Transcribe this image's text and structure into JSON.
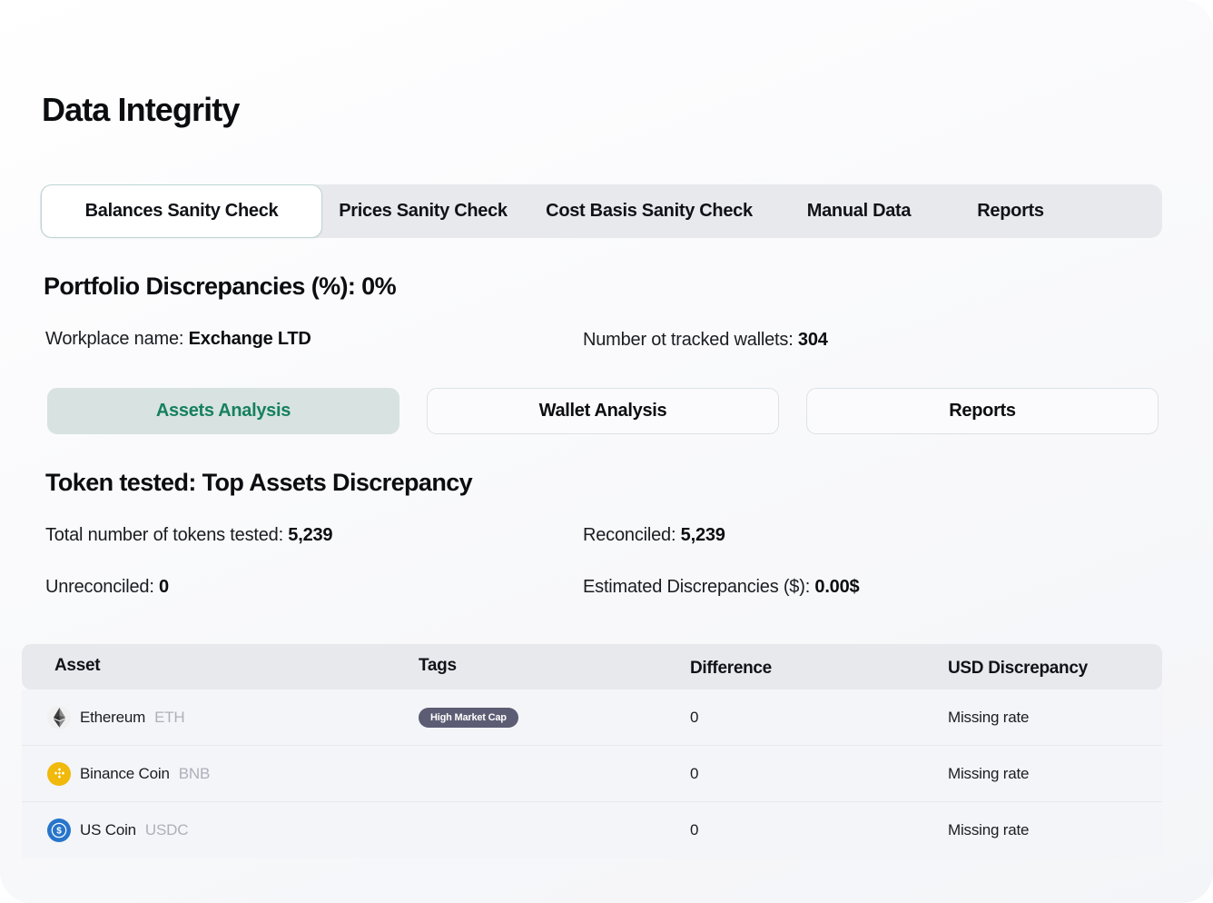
{
  "page": {
    "title": "Data Integrity"
  },
  "tabs": [
    {
      "label": "Balances Sanity Check",
      "active": true
    },
    {
      "label": "Prices Sanity Check",
      "active": false
    },
    {
      "label": "Cost Basis Sanity Check",
      "active": false
    },
    {
      "label": "Manual Data",
      "active": false
    },
    {
      "label": "Reports",
      "active": false
    }
  ],
  "portfolio": {
    "heading": "Portfolio Discrepancies (%): 0%",
    "workplace_label": "Workplace name:",
    "workplace_value": "Exchange LTD",
    "wallets_label": "Number ot tracked wallets:",
    "wallets_value": "304"
  },
  "analysis_buttons": [
    {
      "label": "Assets Analysis",
      "active": true
    },
    {
      "label": "Wallet Analysis",
      "active": false
    },
    {
      "label": "Reports",
      "active": false
    }
  ],
  "token": {
    "heading": "Token tested: Top Assets Discrepancy",
    "total_label": "Total number of tokens tested:",
    "total_value": "5,239",
    "reconciled_label": "Reconciled:",
    "reconciled_value": "5,239",
    "unreconciled_label": "Unreconciled:",
    "unreconciled_value": "0",
    "estimated_label": "Estimated Discrepancies ($):",
    "estimated_value": "0.00$"
  },
  "table": {
    "columns": [
      "Asset",
      "Tags",
      "Difference",
      "USD Discrepancy"
    ],
    "rows": [
      {
        "icon": "ethereum-icon",
        "name": "Ethereum",
        "symbol": "ETH",
        "tag": "High Market Cap",
        "difference": "0",
        "usd_discrepancy": "Missing rate"
      },
      {
        "icon": "binance-coin-icon",
        "name": "Binance Coin",
        "symbol": "BNB",
        "tag": "",
        "difference": "0",
        "usd_discrepancy": "Missing rate"
      },
      {
        "icon": "usd-coin-icon",
        "name": "US Coin",
        "symbol": "USDC",
        "tag": "",
        "difference": "0",
        "usd_discrepancy": "Missing rate"
      }
    ]
  },
  "colors": {
    "accent_green": "#16805f",
    "active_pill_bg": "#d7e2e1",
    "tab_track": "#e8e9ed",
    "badge_bg": "#5c5c74",
    "eth_icon": "#3c3c3d",
    "bnb_icon": "#f0b90b",
    "usdc_icon": "#2775ca"
  }
}
